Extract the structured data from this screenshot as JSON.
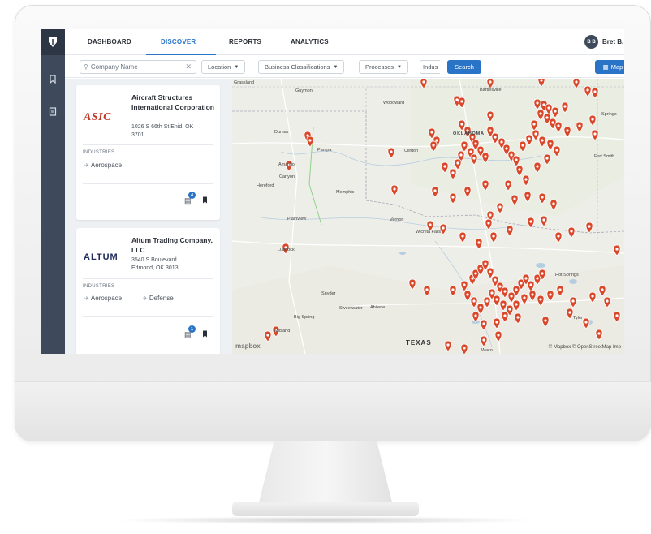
{
  "nav": {
    "tabs": [
      {
        "label": "DASHBOARD"
      },
      {
        "label": "DISCOVER"
      },
      {
        "label": "REPORTS"
      },
      {
        "label": "ANALYTICS"
      }
    ],
    "active_tab": "DISCOVER",
    "user_initials": "B B",
    "user_name": "Bret B."
  },
  "filters": {
    "search_placeholder": "Company Name",
    "location": "Location",
    "business_classifications": "Business Classifications",
    "processes": "Processes",
    "industries_partial": "Indus",
    "search_button": "Search",
    "map_button": "Map"
  },
  "companies": [
    {
      "logo": "ASIC",
      "name": "Aircraft Structures International Corporation",
      "address_line1": "1026 S 66th St Enid, OK",
      "address_line2": "3701",
      "industries_label": "INDUSTRIES",
      "industries": [
        "Aerospace"
      ],
      "report_count": "4"
    },
    {
      "logo": "ALTUM",
      "name": "Altum Trading Company, LLC",
      "address_line1": "3540 S Boulevard",
      "address_line2": "Edmond, OK 3013",
      "industries_label": "INDUSTRIES",
      "industries": [
        "Aerospace",
        "Defense"
      ],
      "report_count": "1"
    }
  ],
  "map": {
    "cities": [
      "Grassland",
      "Guymon",
      "Woodward",
      "Bartlesville",
      "Dumas",
      "Pampa",
      "Amarillo",
      "Clinton",
      "OKLAHOMA",
      "Hereford",
      "Canyon",
      "Memphis",
      "Springs",
      "Fort Smith",
      "Plainview",
      "Vernon",
      "Wichita Falls",
      "Lubbock",
      "Snyder",
      "Sweetwater",
      "Abilene",
      "Big Spring",
      "Midland",
      "Tyler",
      "Hot Springs",
      "TEXAS",
      "Waco"
    ],
    "state_labels": [
      "TEXAS"
    ],
    "attribution": "© Mapbox © OpenStreetMap Imp",
    "brand": "mapbox",
    "pin_color": "#d9482b"
  }
}
